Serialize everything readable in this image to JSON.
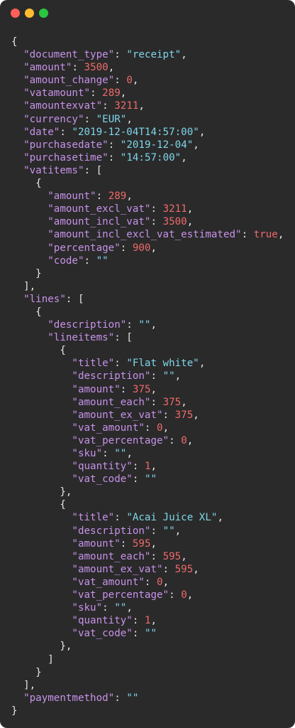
{
  "window": {
    "buttons": [
      {
        "name": "close",
        "color": "#ff5f57"
      },
      {
        "name": "minimize",
        "color": "#febc2e"
      },
      {
        "name": "zoom",
        "color": "#28c840"
      }
    ]
  },
  "colors": {
    "background": "#2a2a2a",
    "key": "#c792ea",
    "string": "#7fd6ea",
    "number": "#ef6a6a",
    "punctuation": "#e6e6e6"
  },
  "code_lines": [
    [
      {
        "t": "p",
        "v": "{"
      }
    ],
    [
      {
        "t": "p",
        "v": "  "
      },
      {
        "t": "k",
        "v": "\"document_type\""
      },
      {
        "t": "p",
        "v": ": "
      },
      {
        "t": "s",
        "v": "\"receipt\""
      },
      {
        "t": "p",
        "v": ","
      }
    ],
    [
      {
        "t": "p",
        "v": "  "
      },
      {
        "t": "k",
        "v": "\"amount\""
      },
      {
        "t": "p",
        "v": ": "
      },
      {
        "t": "n",
        "v": "3500"
      },
      {
        "t": "p",
        "v": ","
      }
    ],
    [
      {
        "t": "p",
        "v": "  "
      },
      {
        "t": "k",
        "v": "\"amount_change\""
      },
      {
        "t": "p",
        "v": ": "
      },
      {
        "t": "n",
        "v": "0"
      },
      {
        "t": "p",
        "v": ","
      }
    ],
    [
      {
        "t": "p",
        "v": "  "
      },
      {
        "t": "k",
        "v": "\"vatamount\""
      },
      {
        "t": "p",
        "v": ": "
      },
      {
        "t": "n",
        "v": "289"
      },
      {
        "t": "p",
        "v": ","
      }
    ],
    [
      {
        "t": "p",
        "v": "  "
      },
      {
        "t": "k",
        "v": "\"amountexvat\""
      },
      {
        "t": "p",
        "v": ": "
      },
      {
        "t": "n",
        "v": "3211"
      },
      {
        "t": "p",
        "v": ","
      }
    ],
    [
      {
        "t": "p",
        "v": "  "
      },
      {
        "t": "k",
        "v": "\"currency\""
      },
      {
        "t": "p",
        "v": ": "
      },
      {
        "t": "s",
        "v": "\"EUR\""
      },
      {
        "t": "p",
        "v": ","
      }
    ],
    [
      {
        "t": "p",
        "v": "  "
      },
      {
        "t": "k",
        "v": "\"date\""
      },
      {
        "t": "p",
        "v": ": "
      },
      {
        "t": "s",
        "v": "\"2019-12-04T14:57:00\""
      },
      {
        "t": "p",
        "v": ","
      }
    ],
    [
      {
        "t": "p",
        "v": "  "
      },
      {
        "t": "k",
        "v": "\"purchasedate\""
      },
      {
        "t": "p",
        "v": ": "
      },
      {
        "t": "s",
        "v": "\"2019-12-04\""
      },
      {
        "t": "p",
        "v": ","
      }
    ],
    [
      {
        "t": "p",
        "v": "  "
      },
      {
        "t": "k",
        "v": "\"purchasetime\""
      },
      {
        "t": "p",
        "v": ": "
      },
      {
        "t": "s",
        "v": "\"14:57:00\""
      },
      {
        "t": "p",
        "v": ","
      }
    ],
    [
      {
        "t": "p",
        "v": "  "
      },
      {
        "t": "k",
        "v": "\"vatitems\""
      },
      {
        "t": "p",
        "v": ": ["
      }
    ],
    [
      {
        "t": "p",
        "v": "    {"
      }
    ],
    [
      {
        "t": "p",
        "v": "      "
      },
      {
        "t": "k",
        "v": "\"amount\""
      },
      {
        "t": "p",
        "v": ": "
      },
      {
        "t": "n",
        "v": "289"
      },
      {
        "t": "p",
        "v": ","
      }
    ],
    [
      {
        "t": "p",
        "v": "      "
      },
      {
        "t": "k",
        "v": "\"amount_excl_vat\""
      },
      {
        "t": "p",
        "v": ": "
      },
      {
        "t": "n",
        "v": "3211"
      },
      {
        "t": "p",
        "v": ","
      }
    ],
    [
      {
        "t": "p",
        "v": "      "
      },
      {
        "t": "k",
        "v": "\"amount_incl_vat\""
      },
      {
        "t": "p",
        "v": ": "
      },
      {
        "t": "n",
        "v": "3500"
      },
      {
        "t": "p",
        "v": ","
      }
    ],
    [
      {
        "t": "p",
        "v": "      "
      },
      {
        "t": "k",
        "v": "\"amount_incl_excl_vat_estimated\""
      },
      {
        "t": "p",
        "v": ": "
      },
      {
        "t": "n",
        "v": "true"
      },
      {
        "t": "p",
        "v": ","
      }
    ],
    [
      {
        "t": "p",
        "v": "      "
      },
      {
        "t": "k",
        "v": "\"percentage\""
      },
      {
        "t": "p",
        "v": ": "
      },
      {
        "t": "n",
        "v": "900"
      },
      {
        "t": "p",
        "v": ","
      }
    ],
    [
      {
        "t": "p",
        "v": "      "
      },
      {
        "t": "k",
        "v": "\"code\""
      },
      {
        "t": "p",
        "v": ": "
      },
      {
        "t": "s",
        "v": "\"\""
      }
    ],
    [
      {
        "t": "p",
        "v": "    }"
      }
    ],
    [
      {
        "t": "p",
        "v": "  ],"
      }
    ],
    [
      {
        "t": "p",
        "v": "  "
      },
      {
        "t": "k",
        "v": "\"lines\""
      },
      {
        "t": "p",
        "v": ": ["
      }
    ],
    [
      {
        "t": "p",
        "v": "    {"
      }
    ],
    [
      {
        "t": "p",
        "v": "      "
      },
      {
        "t": "k",
        "v": "\"description\""
      },
      {
        "t": "p",
        "v": ": "
      },
      {
        "t": "s",
        "v": "\"\""
      },
      {
        "t": "p",
        "v": ","
      }
    ],
    [
      {
        "t": "p",
        "v": "      "
      },
      {
        "t": "k",
        "v": "\"lineitems\""
      },
      {
        "t": "p",
        "v": ": ["
      }
    ],
    [
      {
        "t": "p",
        "v": "        {"
      }
    ],
    [
      {
        "t": "p",
        "v": "          "
      },
      {
        "t": "k",
        "v": "\"title\""
      },
      {
        "t": "p",
        "v": ": "
      },
      {
        "t": "s",
        "v": "\"Flat white\""
      },
      {
        "t": "p",
        "v": ","
      }
    ],
    [
      {
        "t": "p",
        "v": "          "
      },
      {
        "t": "k",
        "v": "\"description\""
      },
      {
        "t": "p",
        "v": ": "
      },
      {
        "t": "s",
        "v": "\"\""
      },
      {
        "t": "p",
        "v": ","
      }
    ],
    [
      {
        "t": "p",
        "v": "          "
      },
      {
        "t": "k",
        "v": "\"amount\""
      },
      {
        "t": "p",
        "v": ": "
      },
      {
        "t": "n",
        "v": "375"
      },
      {
        "t": "p",
        "v": ","
      }
    ],
    [
      {
        "t": "p",
        "v": "          "
      },
      {
        "t": "k",
        "v": "\"amount_each\""
      },
      {
        "t": "p",
        "v": ": "
      },
      {
        "t": "n",
        "v": "375"
      },
      {
        "t": "p",
        "v": ","
      }
    ],
    [
      {
        "t": "p",
        "v": "          "
      },
      {
        "t": "k",
        "v": "\"amount_ex_vat\""
      },
      {
        "t": "p",
        "v": ": "
      },
      {
        "t": "n",
        "v": "375"
      },
      {
        "t": "p",
        "v": ","
      }
    ],
    [
      {
        "t": "p",
        "v": "          "
      },
      {
        "t": "k",
        "v": "\"vat_amount\""
      },
      {
        "t": "p",
        "v": ": "
      },
      {
        "t": "n",
        "v": "0"
      },
      {
        "t": "p",
        "v": ","
      }
    ],
    [
      {
        "t": "p",
        "v": "          "
      },
      {
        "t": "k",
        "v": "\"vat_percentage\""
      },
      {
        "t": "p",
        "v": ": "
      },
      {
        "t": "n",
        "v": "0"
      },
      {
        "t": "p",
        "v": ","
      }
    ],
    [
      {
        "t": "p",
        "v": "          "
      },
      {
        "t": "k",
        "v": "\"sku\""
      },
      {
        "t": "p",
        "v": ": "
      },
      {
        "t": "s",
        "v": "\"\""
      },
      {
        "t": "p",
        "v": ","
      }
    ],
    [
      {
        "t": "p",
        "v": "          "
      },
      {
        "t": "k",
        "v": "\"quantity\""
      },
      {
        "t": "p",
        "v": ": "
      },
      {
        "t": "n",
        "v": "1"
      },
      {
        "t": "p",
        "v": ","
      }
    ],
    [
      {
        "t": "p",
        "v": "          "
      },
      {
        "t": "k",
        "v": "\"vat_code\""
      },
      {
        "t": "p",
        "v": ": "
      },
      {
        "t": "s",
        "v": "\"\""
      }
    ],
    [
      {
        "t": "p",
        "v": "        },"
      }
    ],
    [
      {
        "t": "p",
        "v": "        {"
      }
    ],
    [
      {
        "t": "p",
        "v": "          "
      },
      {
        "t": "k",
        "v": "\"title\""
      },
      {
        "t": "p",
        "v": ": "
      },
      {
        "t": "s",
        "v": "\"Acai Juice XL\""
      },
      {
        "t": "p",
        "v": ","
      }
    ],
    [
      {
        "t": "p",
        "v": "          "
      },
      {
        "t": "k",
        "v": "\"description\""
      },
      {
        "t": "p",
        "v": ": "
      },
      {
        "t": "s",
        "v": "\"\""
      },
      {
        "t": "p",
        "v": ","
      }
    ],
    [
      {
        "t": "p",
        "v": "          "
      },
      {
        "t": "k",
        "v": "\"amount\""
      },
      {
        "t": "p",
        "v": ": "
      },
      {
        "t": "n",
        "v": "595"
      },
      {
        "t": "p",
        "v": ","
      }
    ],
    [
      {
        "t": "p",
        "v": "          "
      },
      {
        "t": "k",
        "v": "\"amount_each\""
      },
      {
        "t": "p",
        "v": ": "
      },
      {
        "t": "n",
        "v": "595"
      },
      {
        "t": "p",
        "v": ","
      }
    ],
    [
      {
        "t": "p",
        "v": "          "
      },
      {
        "t": "k",
        "v": "\"amount_ex_vat\""
      },
      {
        "t": "p",
        "v": ": "
      },
      {
        "t": "n",
        "v": "595"
      },
      {
        "t": "p",
        "v": ","
      }
    ],
    [
      {
        "t": "p",
        "v": "          "
      },
      {
        "t": "k",
        "v": "\"vat_amount\""
      },
      {
        "t": "p",
        "v": ": "
      },
      {
        "t": "n",
        "v": "0"
      },
      {
        "t": "p",
        "v": ","
      }
    ],
    [
      {
        "t": "p",
        "v": "          "
      },
      {
        "t": "k",
        "v": "\"vat_percentage\""
      },
      {
        "t": "p",
        "v": ": "
      },
      {
        "t": "n",
        "v": "0"
      },
      {
        "t": "p",
        "v": ","
      }
    ],
    [
      {
        "t": "p",
        "v": "          "
      },
      {
        "t": "k",
        "v": "\"sku\""
      },
      {
        "t": "p",
        "v": ": "
      },
      {
        "t": "s",
        "v": "\"\""
      },
      {
        "t": "p",
        "v": ","
      }
    ],
    [
      {
        "t": "p",
        "v": "          "
      },
      {
        "t": "k",
        "v": "\"quantity\""
      },
      {
        "t": "p",
        "v": ": "
      },
      {
        "t": "n",
        "v": "1"
      },
      {
        "t": "p",
        "v": ","
      }
    ],
    [
      {
        "t": "p",
        "v": "          "
      },
      {
        "t": "k",
        "v": "\"vat_code\""
      },
      {
        "t": "p",
        "v": ": "
      },
      {
        "t": "s",
        "v": "\"\""
      }
    ],
    [
      {
        "t": "p",
        "v": "        },"
      }
    ],
    [
      {
        "t": "p",
        "v": "      ]"
      }
    ],
    [
      {
        "t": "p",
        "v": "    }"
      }
    ],
    [
      {
        "t": "p",
        "v": "  ],"
      }
    ],
    [
      {
        "t": "p",
        "v": "  "
      },
      {
        "t": "k",
        "v": "\"paymentmethod\""
      },
      {
        "t": "p",
        "v": ": "
      },
      {
        "t": "s",
        "v": "\"\""
      }
    ],
    [
      {
        "t": "p",
        "v": "}"
      }
    ]
  ]
}
